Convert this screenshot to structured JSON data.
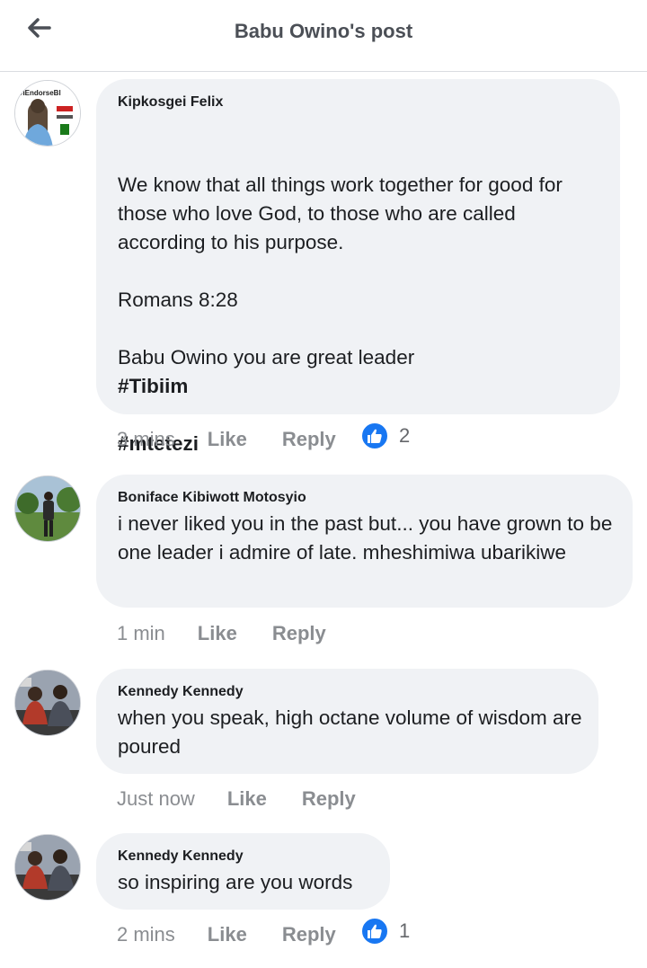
{
  "header": {
    "title": "Babu Owino's post"
  },
  "comments": [
    {
      "author": "Kipkosgei Felix",
      "text": "We know that all things work together for good for those who love God, to those who are called according to his purpose.\n\nRomans 8:28\n\nBabu Owino you are great leader",
      "hashtags": [
        "#Tibiim",
        "#mtetezi"
      ],
      "avatar_text": "#IEndorseBl",
      "time": "3 mins",
      "like_label": "Like",
      "reply_label": "Reply",
      "reactions": "2"
    },
    {
      "author": "Boniface Kibiwott Motosyio",
      "text": "i never liked you in the past but... you have grown to be one leader i admire of late. mheshimiwa ubarikiwe",
      "time": "1 min",
      "like_label": "Like",
      "reply_label": "Reply"
    },
    {
      "author": "Kennedy Kennedy",
      "text": "when you speak, high octane volume of wisdom are poured",
      "time": "Just now",
      "like_label": "Like",
      "reply_label": "Reply"
    },
    {
      "author": "Kennedy Kennedy",
      "text": "so inspiring are you words",
      "time": "2 mins",
      "like_label": "Like",
      "reply_label": "Reply",
      "reactions": "1"
    }
  ],
  "icons": {
    "back": "arrow-left-icon",
    "like": "thumbs-up-icon"
  },
  "colors": {
    "bubble": "#f0f2f5",
    "reaction_blue": "#1877f2",
    "meta": "#8a8d91"
  }
}
